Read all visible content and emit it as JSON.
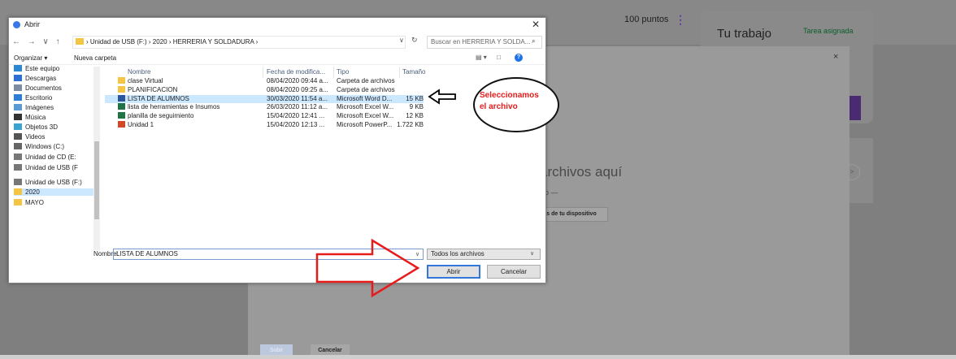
{
  "background": {
    "points": "100 puntos",
    "card_title": "Tu trabajo",
    "card_status": "Tarea asignada",
    "drop_text": "archivos aquí",
    "drop_or": "o —",
    "device_button": "os de tu dispositivo",
    "upload_button": "Subir",
    "cancel_button": "Cancelar",
    "close": "×",
    "kebab": "⋮"
  },
  "dialog": {
    "title": "Abrir",
    "close": "✕",
    "nav_arrows": "← → ∨ ↑",
    "path": "› Unidad de USB (F:)  ›  2020  ›  HERRERIA Y SOLDADURA  ›",
    "path_dropdown": "∨",
    "refresh": "↻",
    "search_placeholder": "Buscar en HERRERIA Y SOLDA...",
    "search_icon": "⌕",
    "organize": "Organizar ▾",
    "new_folder": "Nueva carpeta",
    "view_icon": "▤ ▾",
    "pane_icon": "□",
    "help_icon": "?",
    "nav_items": [
      {
        "label": "Este equipo",
        "icon": "pc-icon",
        "color": "#2a87d6"
      },
      {
        "label": "Descargas",
        "icon": "download-icon",
        "color": "#2a6fd6"
      },
      {
        "label": "Documentos",
        "icon": "documents-icon",
        "color": "#7b8ca3"
      },
      {
        "label": "Escritorio",
        "icon": "desktop-icon",
        "color": "#2c7fd8"
      },
      {
        "label": "Imágenes",
        "icon": "pictures-icon",
        "color": "#5b9bd5"
      },
      {
        "label": "Música",
        "icon": "music-icon",
        "color": "#333"
      },
      {
        "label": "Objetos 3D",
        "icon": "objects3d-icon",
        "color": "#3ba3d0"
      },
      {
        "label": "Videos",
        "icon": "videos-icon",
        "color": "#555"
      },
      {
        "label": "Windows (C:)",
        "icon": "drive-icon",
        "color": "#666"
      },
      {
        "label": "Unidad de CD (E:",
        "icon": "cd-drive-icon",
        "color": "#777"
      },
      {
        "label": "Unidad de USB (F",
        "icon": "usb-drive-icon",
        "color": "#777"
      },
      {
        "label": "Unidad de USB (F:)",
        "icon": "usb-drive-icon",
        "color": "#777"
      },
      {
        "label": "2020",
        "icon": "folder-icon",
        "color": "#f5c442"
      },
      {
        "label": "MAYO",
        "icon": "folder-icon",
        "color": "#f5c442"
      }
    ],
    "columns": [
      "Nombre",
      "Fecha de modifica...",
      "Tipo",
      "Tamaño"
    ],
    "files": [
      {
        "name": "clase Virtual",
        "date": "08/04/2020 09:44 a...",
        "type": "Carpeta de archivos",
        "size": "",
        "icon": "folder-icon",
        "color": "#f5c442"
      },
      {
        "name": "PLANIFICACION",
        "date": "08/04/2020 09:25 a...",
        "type": "Carpeta de archivos",
        "size": "",
        "icon": "folder-icon",
        "color": "#f5c442"
      },
      {
        "name": "LISTA DE ALUMNOS",
        "date": "30/03/2020 11:54 a...",
        "type": "Microsoft Word D...",
        "size": "15 KB",
        "icon": "word-icon",
        "color": "#2b579a"
      },
      {
        "name": "lista de herramientas e Insumos",
        "date": "26/03/2020 11:12 a...",
        "type": "Microsoft Excel W...",
        "size": "9 KB",
        "icon": "excel-icon",
        "color": "#217346"
      },
      {
        "name": "planilla de seguimiento",
        "date": "15/04/2020 12:41 ...",
        "type": "Microsoft Excel W...",
        "size": "12 KB",
        "icon": "excel-icon",
        "color": "#217346"
      },
      {
        "name": "Unidad 1",
        "date": "15/04/2020 12:13 ...",
        "type": "Microsoft PowerP...",
        "size": "1.722 KB",
        "icon": "powerpoint-icon",
        "color": "#d24726"
      }
    ],
    "selected_index": 2,
    "filename_label": "Nombre:",
    "filename_value": "LISTA DE ALUMNOS",
    "filetype": "Todos los archivos",
    "open_button": "Abrir",
    "cancel_button": "Cancelar"
  },
  "annotation": {
    "text_line1": "Seleccionamos",
    "text_line2": "el archivo",
    "color": "#e81b1b"
  }
}
